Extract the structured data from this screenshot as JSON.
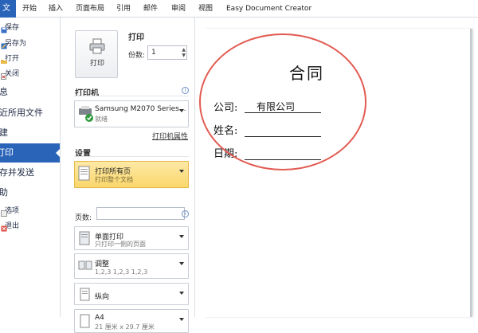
{
  "ribbon": {
    "file_tab": "文件",
    "tabs": [
      "开始",
      "插入",
      "页面布局",
      "引用",
      "邮件",
      "审阅",
      "视图",
      "Easy Document Creator"
    ]
  },
  "nav": {
    "save": "保存",
    "save_as": "另存为",
    "open": "打开",
    "close": "关闭",
    "info": "信息",
    "recent": "最近所用文件",
    "new": "新建",
    "print": "打印",
    "save_send": "保存并发送",
    "help": "帮助",
    "options": "选项",
    "exit": "退出"
  },
  "print_panel": {
    "title": "打印",
    "print_button": "打印",
    "copies_label": "份数:",
    "copies_value": "1",
    "printer_section": "打印机",
    "printer_name": "Samsung M2070 Series...",
    "printer_status": "就绪",
    "printer_props": "打印机属性",
    "settings_section": "设置",
    "print_all": "打印所有页",
    "print_all_sub": "打印整个文档",
    "pages_label": "页数:",
    "one_sided": "单面打印",
    "one_sided_sub": "只打印一侧的页面",
    "collated": "调整",
    "collated_sub": "1,2,3    1,2,3    1,2,3",
    "orientation": "纵向",
    "paper_size": "A4",
    "paper_size_sub": "21 厘米 x 29.7 厘米"
  },
  "document": {
    "title": "合同",
    "company_label": "公司:",
    "company_value": "有限公司",
    "name_label": "姓名:",
    "date_label": "日期:"
  },
  "colors": {
    "accent": "#2a64b8",
    "highlight": "#fbd76c",
    "annotation": "#e25b52"
  }
}
